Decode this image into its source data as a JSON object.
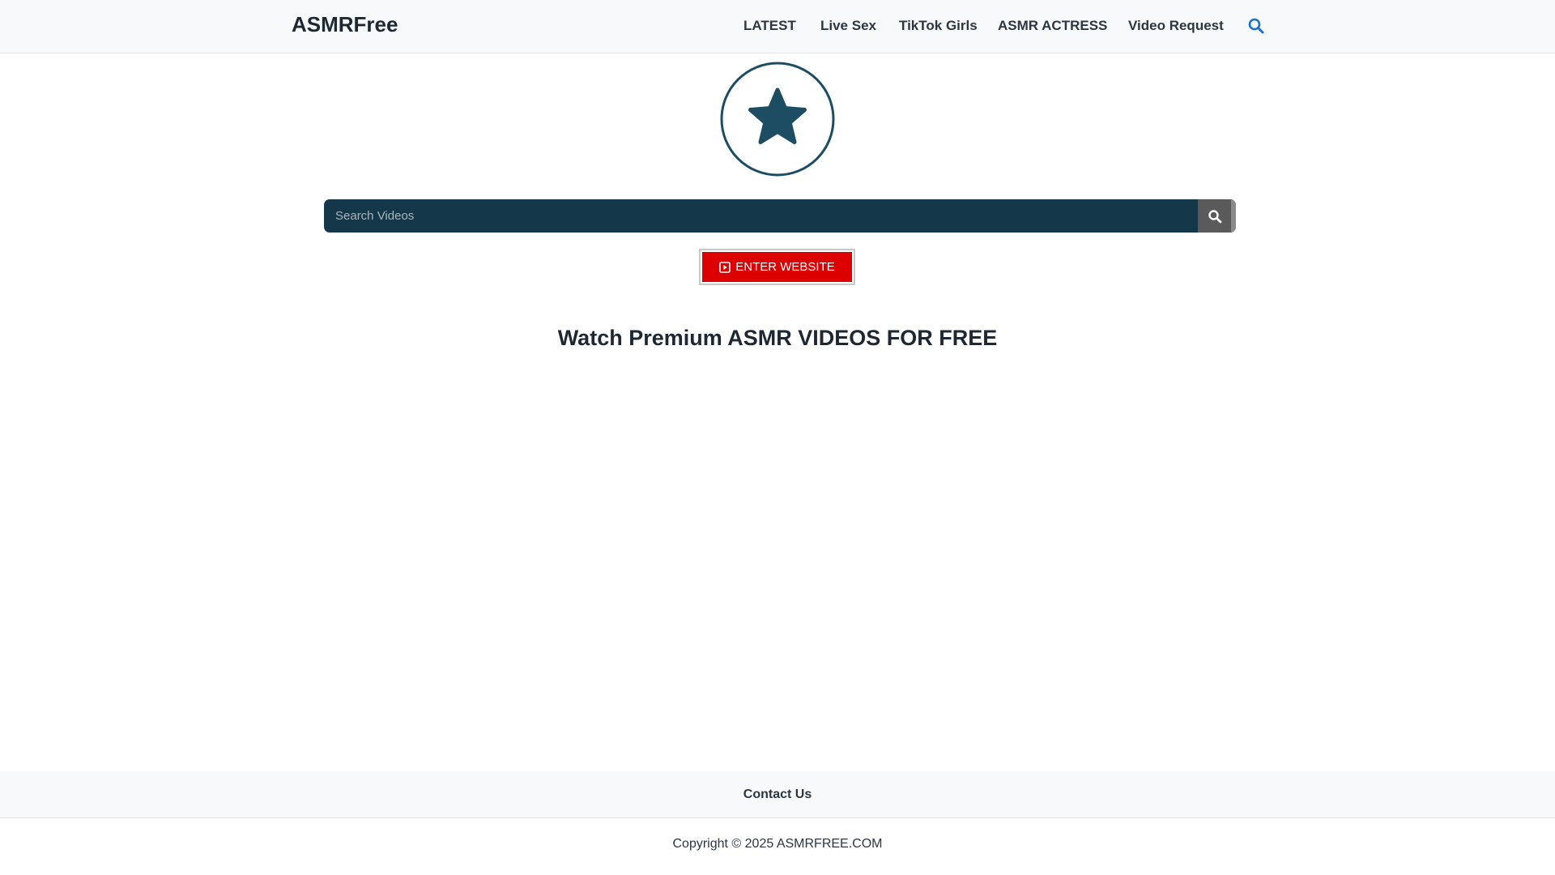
{
  "header": {
    "site_title": "ASMRFree",
    "nav": [
      {
        "label": "LATEST"
      },
      {
        "label": "Live Sex"
      },
      {
        "label": "TikTok Girls"
      },
      {
        "label": "ASMR ACTRESS"
      },
      {
        "label": "Video Request"
      }
    ],
    "search_icon": "search-icon"
  },
  "logo": {
    "icon": "star-icon",
    "color": "#1d4d63"
  },
  "search": {
    "placeholder": "Search Videos",
    "button_icon": "search-icon",
    "bar_color": "#15374a"
  },
  "enter_button": {
    "label": "ENTER WEBSITE",
    "icon": "play-square-icon",
    "color": "#dd0000"
  },
  "headline": "Watch Premium ASMR VIDEOS FOR FREE",
  "footer": {
    "contact_label": "Contact Us",
    "copyright": "Copyright © 2025 ASMRFREE.COM"
  }
}
